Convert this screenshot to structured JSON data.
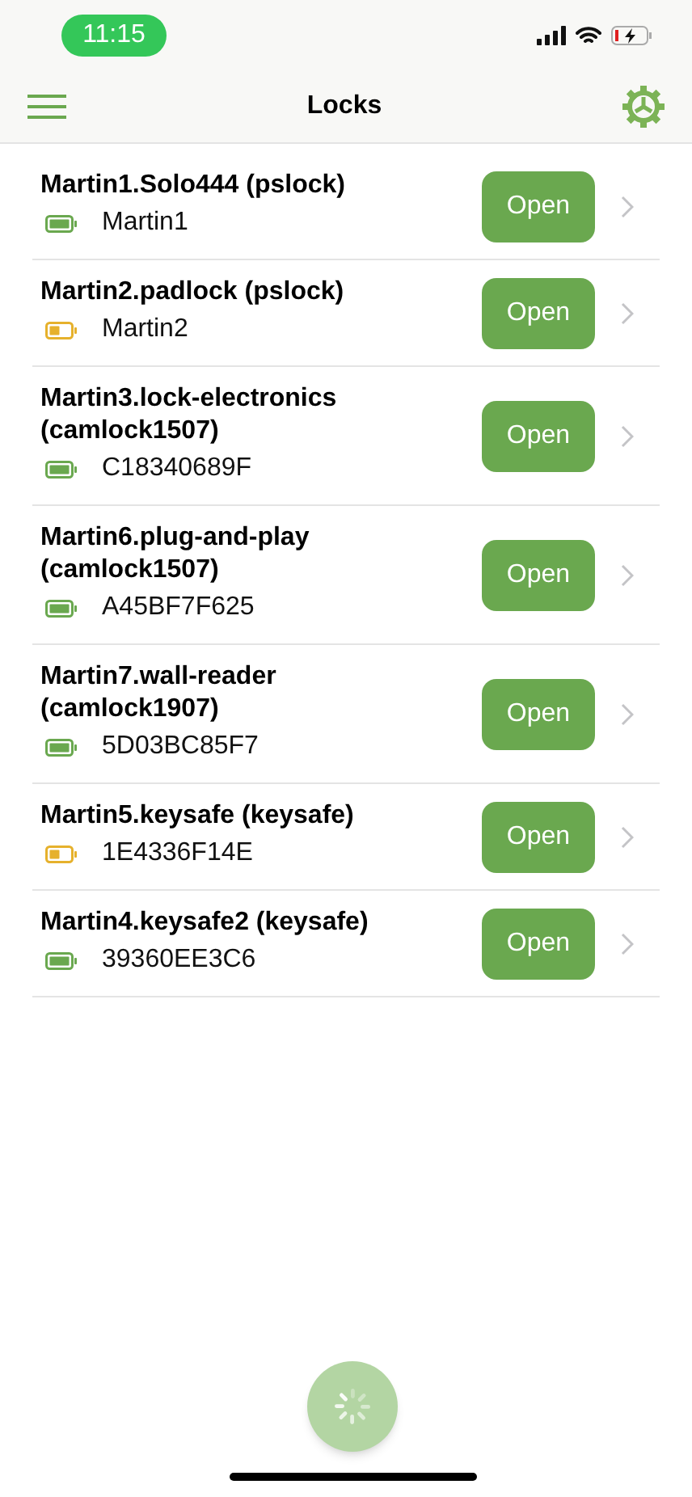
{
  "status_bar": {
    "time": "11:15"
  },
  "nav": {
    "title": "Locks"
  },
  "locks": [
    {
      "name": "Martin1.Solo444 (pslock)",
      "color": "#6aa84f",
      "id": "Martin1",
      "button": "Open"
    },
    {
      "name": "Martin2.padlock (pslock)",
      "color": "#e6b12c",
      "id": "Martin2",
      "button": "Open"
    },
    {
      "name": "Martin3.lock-electronics (camlock1507)",
      "color": "#6aa84f",
      "id": "C18340689F",
      "button": "Open"
    },
    {
      "name": "Martin6.plug-and-play (camlock1507)",
      "color": "#6aa84f",
      "id": "A45BF7F625",
      "button": "Open"
    },
    {
      "name": "Martin7.wall-reader (camlock1907)",
      "color": "#6aa84f",
      "id": "5D03BC85F7",
      "button": "Open"
    },
    {
      "name": "Martin5.keysafe (keysafe)",
      "color": "#e6b12c",
      "id": "1E4336F14E",
      "button": "Open"
    },
    {
      "name": "Martin4.keysafe2 (keysafe)",
      "color": "#6aa84f",
      "id": "39360EE3C6",
      "button": "Open"
    }
  ]
}
